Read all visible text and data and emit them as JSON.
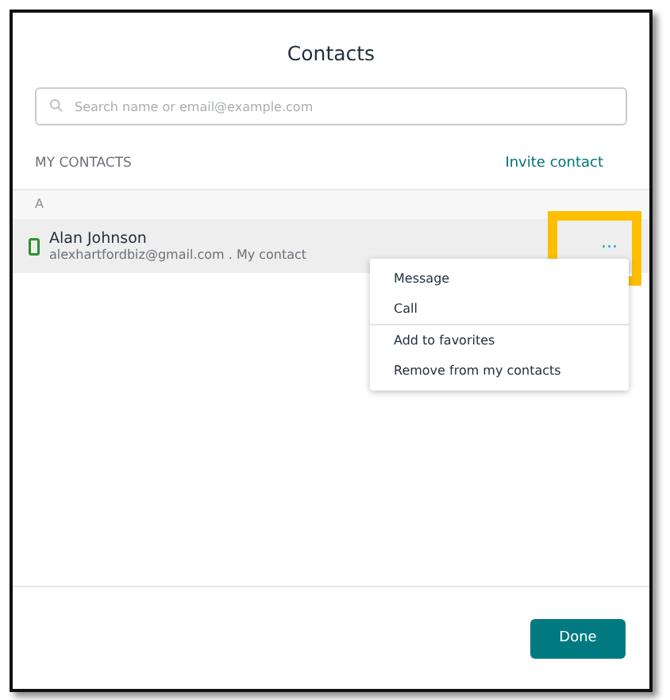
{
  "dialog": {
    "title": "Contacts"
  },
  "search": {
    "placeholder": "Search name or email@example.com"
  },
  "section": {
    "heading": "MY CONTACTS",
    "action": "Invite contact"
  },
  "groups": [
    {
      "letter": "A",
      "contacts": [
        {
          "name": "Alan Johnson",
          "detail": "alexhartfordbiz@gmail.com . My contact",
          "more": "···",
          "highlighted": true
        }
      ]
    }
  ],
  "menu": {
    "groups": [
      [
        "Message",
        "Call"
      ],
      [
        "Add to favorites",
        "Remove from my contacts"
      ]
    ]
  },
  "buttons": [
    "Done"
  ]
}
